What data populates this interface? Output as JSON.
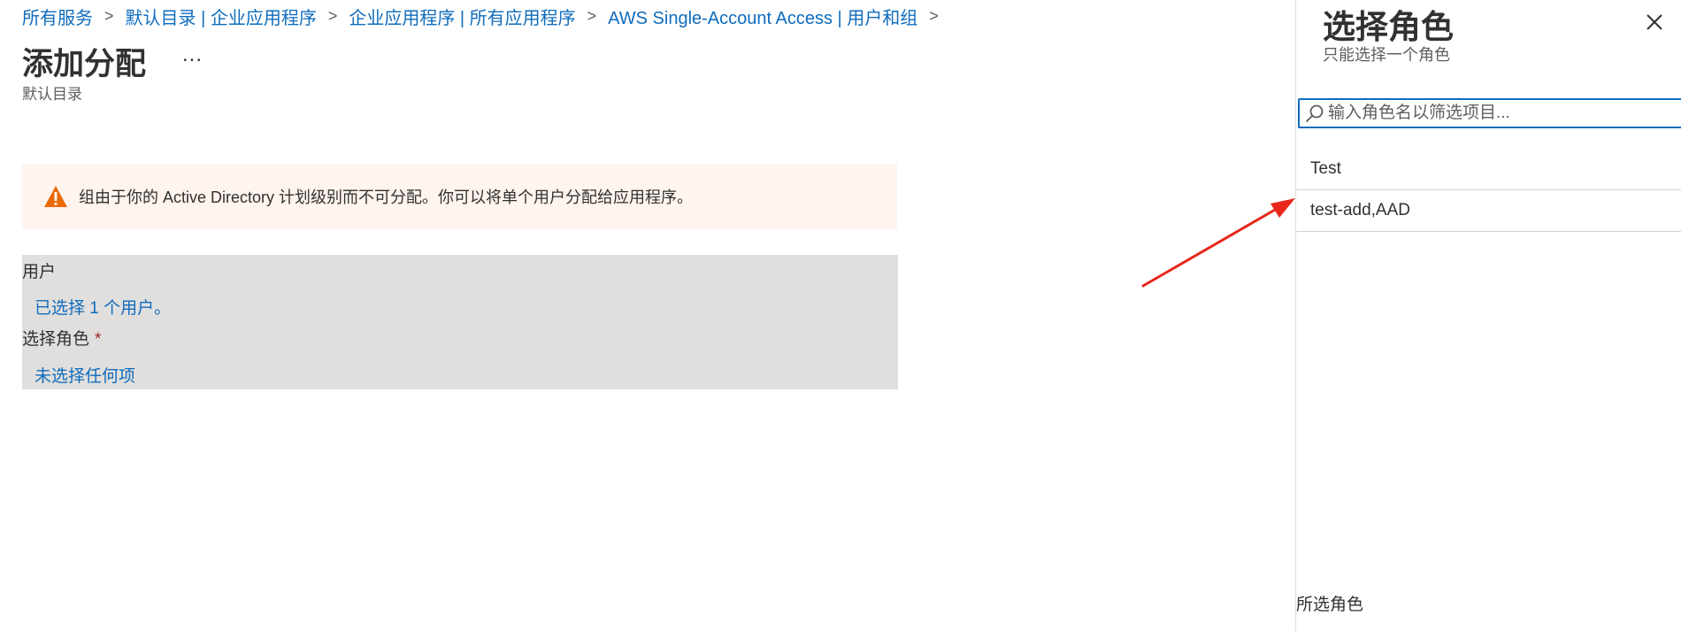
{
  "breadcrumb": {
    "items": [
      "所有服务",
      "默认目录 | 企业应用程序",
      "企业应用程序 | 所有应用程序",
      "AWS Single-Account Access | 用户和组"
    ],
    "separator": ">"
  },
  "page": {
    "title": "添加分配",
    "more": "...",
    "subtitle": "默认目录"
  },
  "warning": {
    "text": "组由于你的 Active Directory 计划级别而不可分配。你可以将单个用户分配给应用程序。",
    "color": "#ea6a00"
  },
  "assignment": {
    "users_label": "用户",
    "users_value": "已选择 1 个用户。",
    "role_label": "选择角色",
    "required_mark": "*",
    "role_value": "未选择任何项"
  },
  "side_panel": {
    "title": "选择角色",
    "subtitle": "只能选择一个角色",
    "close_icon": "close-icon",
    "search_placeholder": "输入角色名以筛选项目...",
    "roles": [
      "Test",
      "test-add,AAD"
    ],
    "selected_label": "所选角色"
  },
  "colors": {
    "link": "#0f6cbd",
    "annotation_arrow": "#e8271a"
  }
}
